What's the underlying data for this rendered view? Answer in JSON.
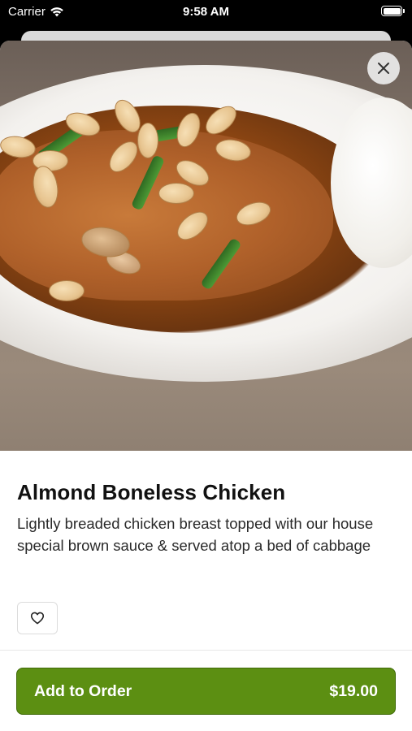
{
  "status_bar": {
    "carrier": "Carrier",
    "time": "9:58 AM"
  },
  "item": {
    "name": "Almond Boneless Chicken",
    "description": "Lightly breaded chicken breast topped with our house special brown sauce & served atop a bed of cabbage"
  },
  "footer": {
    "add_label": "Add to Order",
    "price": "$19.00"
  },
  "icons": {
    "close": "close-icon",
    "favorite": "heart-icon",
    "wifi": "wifi-icon",
    "battery": "battery-icon"
  },
  "colors": {
    "accent": "#5c8f12"
  }
}
